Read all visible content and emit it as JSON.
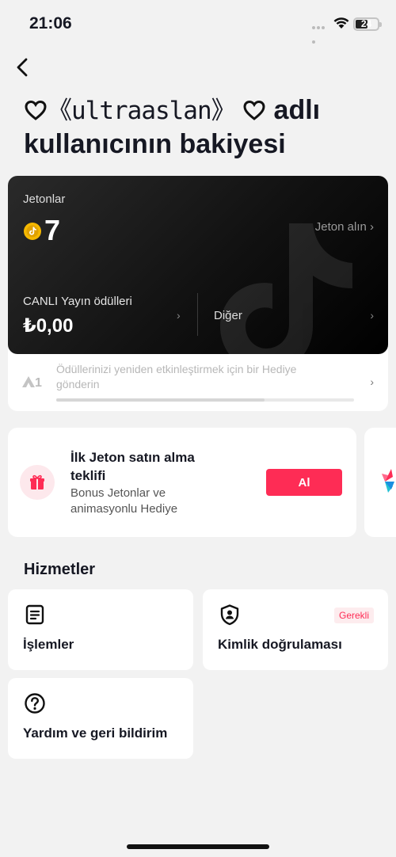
{
  "status_bar": {
    "time": "21:06",
    "battery": "24"
  },
  "header": {
    "title_prefix": "♡ 《",
    "username_stylized": "𝕦𝕝𝕥𝕣𝕒𝕒𝕤𝕝𝕒𝕟",
    "title_parts": {
      "open": "《",
      "user": "ultraaslan",
      "close": "》",
      "suffix": " adlı kullanıcının bakiyesi"
    }
  },
  "balance": {
    "coins_label": "Jetonlar",
    "coin_count": "7",
    "get_coins": "Jeton alın ›",
    "live_label": "CANLI Yayın ödülleri",
    "live_value": "₺0,00",
    "other_label": "Diğer",
    "chevron": "›",
    "level": "1",
    "rewards_text": "Ödüllerinizi yeniden etkinleştirmek için bir Hediye gönderin",
    "rewards_progress": 0.7
  },
  "offer": {
    "title": "İlk Jeton satın alma teklifi",
    "subtitle": "Bonus Jetonlar ve animasyonlu Hediye",
    "button": "Al"
  },
  "services": {
    "heading": "Hizmetler",
    "items": [
      {
        "label": "İşlemler",
        "icon": "document-icon"
      },
      {
        "label": "Kimlik doğrulaması",
        "icon": "shield-user-icon",
        "badge": "Gerekli"
      },
      {
        "label": "Yardım ve geri bildirim",
        "icon": "question-icon"
      }
    ]
  },
  "colors": {
    "accent": "#fe2c55",
    "card_dark": "#111111",
    "coin": "#f5b800"
  }
}
